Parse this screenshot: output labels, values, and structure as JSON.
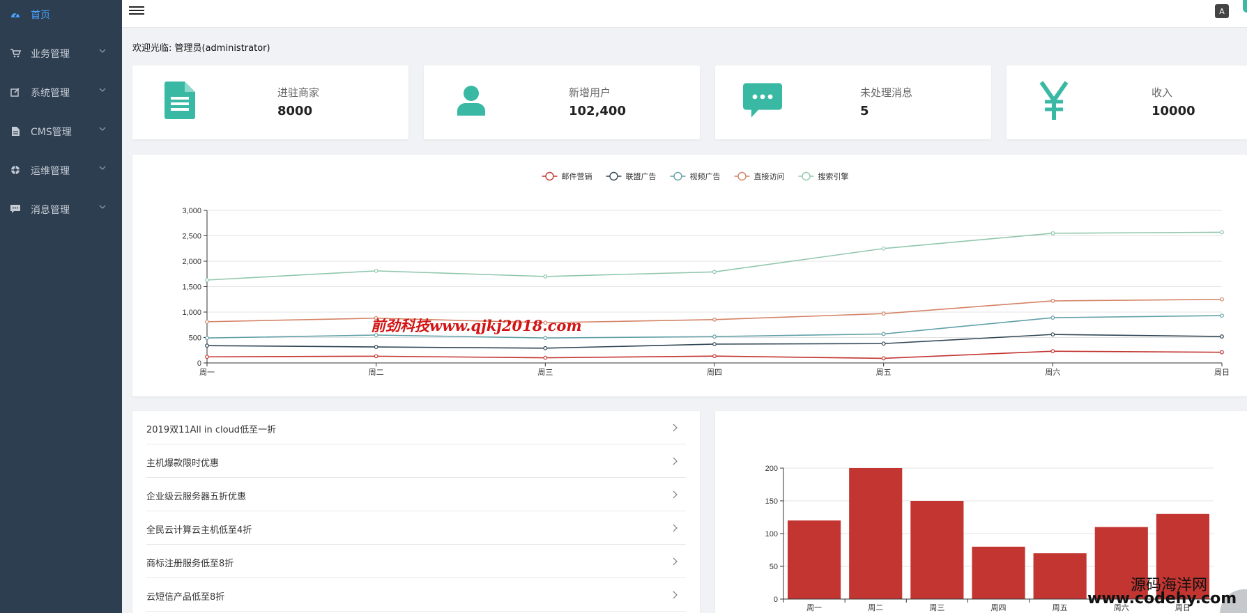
{
  "sidebar": {
    "items": [
      {
        "label": "首页",
        "icon": "dashboard-icon"
      },
      {
        "label": "业务管理",
        "icon": "cart-icon"
      },
      {
        "label": "系统管理",
        "icon": "edit-icon"
      },
      {
        "label": "CMS管理",
        "icon": "document-icon"
      },
      {
        "label": "运维管理",
        "icon": "lifebuoy-icon"
      },
      {
        "label": "消息管理",
        "icon": "comment-icon"
      }
    ]
  },
  "topbar": {
    "lang_icon_text": "A"
  },
  "welcome": "欢迎光临: 管理员(administrator)",
  "stats": [
    {
      "label": "进驻商家",
      "value": "8000",
      "icon": "file-icon"
    },
    {
      "label": "新增用户",
      "value": "102,400",
      "icon": "user-icon"
    },
    {
      "label": "未处理消息",
      "value": "5",
      "icon": "chat-icon"
    },
    {
      "label": "收入",
      "value": "10000",
      "icon": "yen-icon"
    }
  ],
  "chart_data": [
    {
      "type": "line",
      "categories": [
        "周一",
        "周二",
        "周三",
        "周四",
        "周五",
        "周六",
        "周日"
      ],
      "series": [
        {
          "name": "邮件营销",
          "color": "#c23531",
          "values": [
            120,
            132,
            101,
            134,
            90,
            230,
            210
          ]
        },
        {
          "name": "联盟广告",
          "color": "#2f4554",
          "values": [
            340,
            314,
            290,
            370,
            380,
            560,
            520
          ]
        },
        {
          "name": "视频广告",
          "color": "#61a0a8",
          "values": [
            490,
            548,
            491,
            518,
            570,
            890,
            930
          ]
        },
        {
          "name": "直接访问",
          "color": "#d48265",
          "values": [
            810,
            880,
            791,
            852,
            970,
            1220,
            1250
          ]
        },
        {
          "name": "搜索引擎",
          "color": "#91c7ae",
          "values": [
            1630,
            1810,
            1700,
            1790,
            2250,
            2550,
            2570
          ]
        }
      ],
      "ylim": [
        0,
        3000
      ],
      "yticks": [
        "0",
        "500",
        "1,000",
        "1,500",
        "2,000",
        "2,500",
        "3,000"
      ],
      "grid": true,
      "legend": "top-center"
    },
    {
      "type": "bar",
      "categories": [
        "周一",
        "周二",
        "周三",
        "周四",
        "周五",
        "周六",
        "周日"
      ],
      "values": [
        120,
        200,
        150,
        80,
        70,
        110,
        130
      ],
      "color": "#c23531",
      "ylim": [
        0,
        200
      ],
      "yticks": [
        "0",
        "50",
        "100",
        "150",
        "200"
      ],
      "grid": true
    }
  ],
  "promotions": [
    "2019双11All in cloud低至一折",
    "主机爆款限时优惠",
    "企业级云服务器五折优惠",
    "全民云计算云主机低至4折",
    "商标注册服务低至8折",
    "云短信产品低至8折"
  ],
  "watermarks": {
    "red": "前劲科技www.qjkj2018.com",
    "site_cn": "源码海洋网",
    "site_url": "www.codehy.com"
  }
}
